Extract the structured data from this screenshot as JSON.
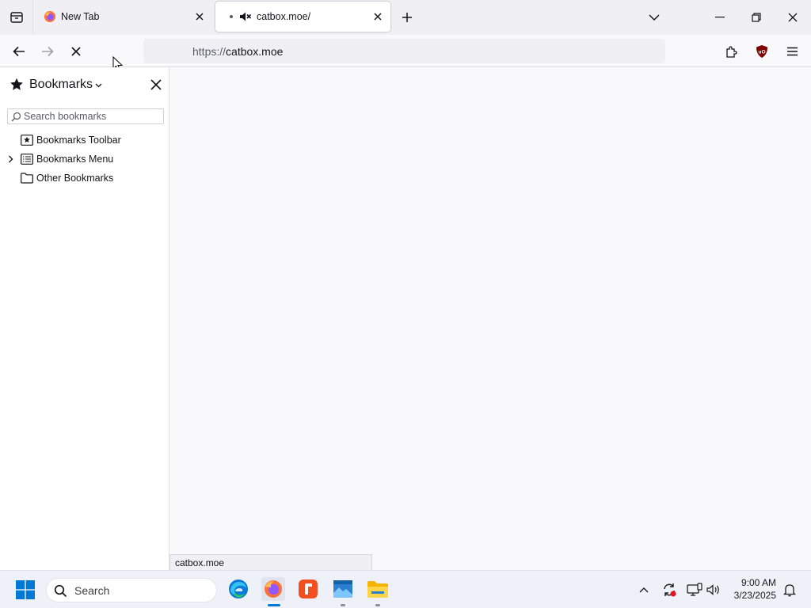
{
  "browser": {
    "tabs": [
      {
        "title": "New Tab",
        "active": false
      },
      {
        "title": "catbox.moe/",
        "active": true
      }
    ],
    "url": {
      "scheme": "https://",
      "host": "catbox.moe"
    },
    "status_text": "catbox.moe"
  },
  "sidebar": {
    "title": "Bookmarks",
    "search_placeholder": "Search bookmarks",
    "items": [
      {
        "label": "Bookmarks Toolbar",
        "icon": "bookmarks-toolbar-icon"
      },
      {
        "label": "Bookmarks Menu",
        "icon": "bookmarks-menu-icon",
        "expandable": true
      },
      {
        "label": "Other Bookmarks",
        "icon": "folder-icon"
      }
    ]
  },
  "taskbar": {
    "search_label": "Search",
    "apps": [
      "edge-icon",
      "firefox-icon",
      "flip-app-icon",
      "photos-icon",
      "file-explorer-icon"
    ],
    "clock": {
      "time": "9:00 AM",
      "date": "3/23/2025"
    }
  },
  "colors": {
    "accent": "#0061e0",
    "ublock": "#800000",
    "windows_blue": "#0078d4"
  }
}
